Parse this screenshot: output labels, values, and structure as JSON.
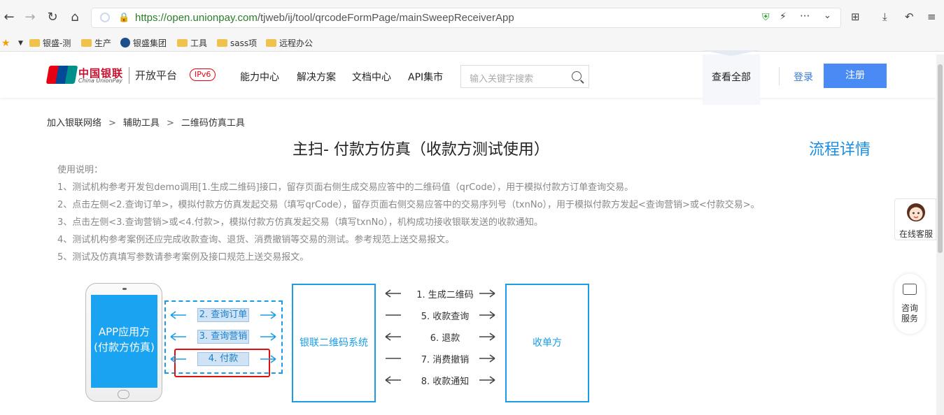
{
  "browser": {
    "url_scheme_host": "https://open.unionpay.com",
    "url_path": "/tjweb/ij/tool/qrcodeFormPage/mainSweepReceiverApp",
    "bookmarks": [
      "银盛-测",
      "生产",
      "银盛集团",
      "工具",
      "sass项",
      "远程办公"
    ]
  },
  "header": {
    "logo_cn": "中国银联",
    "logo_en": "China UnionPay",
    "platform": "开放平台",
    "ipv6": "IPv6",
    "nav": [
      "能力中心",
      "解决方案",
      "文档中心",
      "API集市"
    ],
    "search_placeholder": "输入关键字搜索",
    "view_all": "查看全部",
    "login": "登录",
    "register": "注册"
  },
  "breadcrumb": [
    "加入银联网络",
    "辅助工具",
    "二维码仿真工具"
  ],
  "page": {
    "title": "主扫- 付款方仿真（收款方测试使用）",
    "flow_link": "流程详情",
    "instructions": [
      "使用说明：",
      "1、测试机构参考开发包demo调用[1.生成二维码]接口，留存页面右侧生成交易应答中的二维码值（qrCode），用于模拟付款方订单查询交易。",
      "2、点击左侧<2.查询订单>，模拟付款方仿真发起交易（填写qrCode），留存页面右侧交易应答中的交易序列号（txnNo），用于模拟付款方发起<查询营销>或<付款交易>。",
      "3、点击左侧<3.查询营销>或<4.付款>，模拟付款方仿真发起交易（填写txnNo），机构成功接收银联发送的收款通知。",
      "4、测试机构参考案例还应完成收款查询、退货、消费撤销等交易的测试。参考规范上送交易报文。",
      "5、测试及仿真填写参数请参考案例及接口规范上送交易报文。"
    ]
  },
  "side": {
    "customer_service": "在线客服",
    "consult_line1": "咨询",
    "consult_line2": "服务"
  },
  "diagram": {
    "app_line1": "APP应用方",
    "app_line2": "(付款方仿真)",
    "buttons": [
      "2. 查询订单",
      "3. 查询营销",
      "4. 付款"
    ],
    "system": "银联二维码系统",
    "acquirer": "收单方",
    "steps": [
      "1. 生成二维码",
      "5. 收款查询",
      "6. 退款",
      "7. 消费撤销",
      "8. 收款通知"
    ]
  },
  "colors": {
    "accent_blue": "#1a9de6",
    "register_blue": "#4a8af4",
    "highlight_red": "#e01010",
    "brand_red": "#c8102e"
  }
}
